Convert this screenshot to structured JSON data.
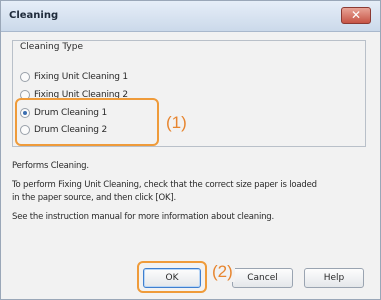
{
  "window": {
    "title": "Cleaning",
    "close_label": "✕"
  },
  "group": {
    "title": "Cleaning Type",
    "options": [
      {
        "label": "Fixing Unit Cleaning 1",
        "checked": false
      },
      {
        "label": "Fixing Unit Cleaning 2",
        "checked": false
      },
      {
        "label": "Drum Cleaning 1",
        "checked": true
      },
      {
        "label": "Drum Cleaning 2",
        "checked": false
      }
    ]
  },
  "messages": {
    "line1": "Performs Cleaning.",
    "line2a": "To perform Fixing Unit Cleaning, check that the correct size paper is loaded",
    "line2b": "in the paper source, and then click [OK].",
    "line3": "See the instruction manual for more information about cleaning."
  },
  "buttons": {
    "ok": "OK",
    "cancel": "Cancel",
    "help": "Help"
  },
  "annotations": {
    "callout1": "(1)",
    "callout2": "(2)",
    "accent_color": "#ef9b3a"
  }
}
